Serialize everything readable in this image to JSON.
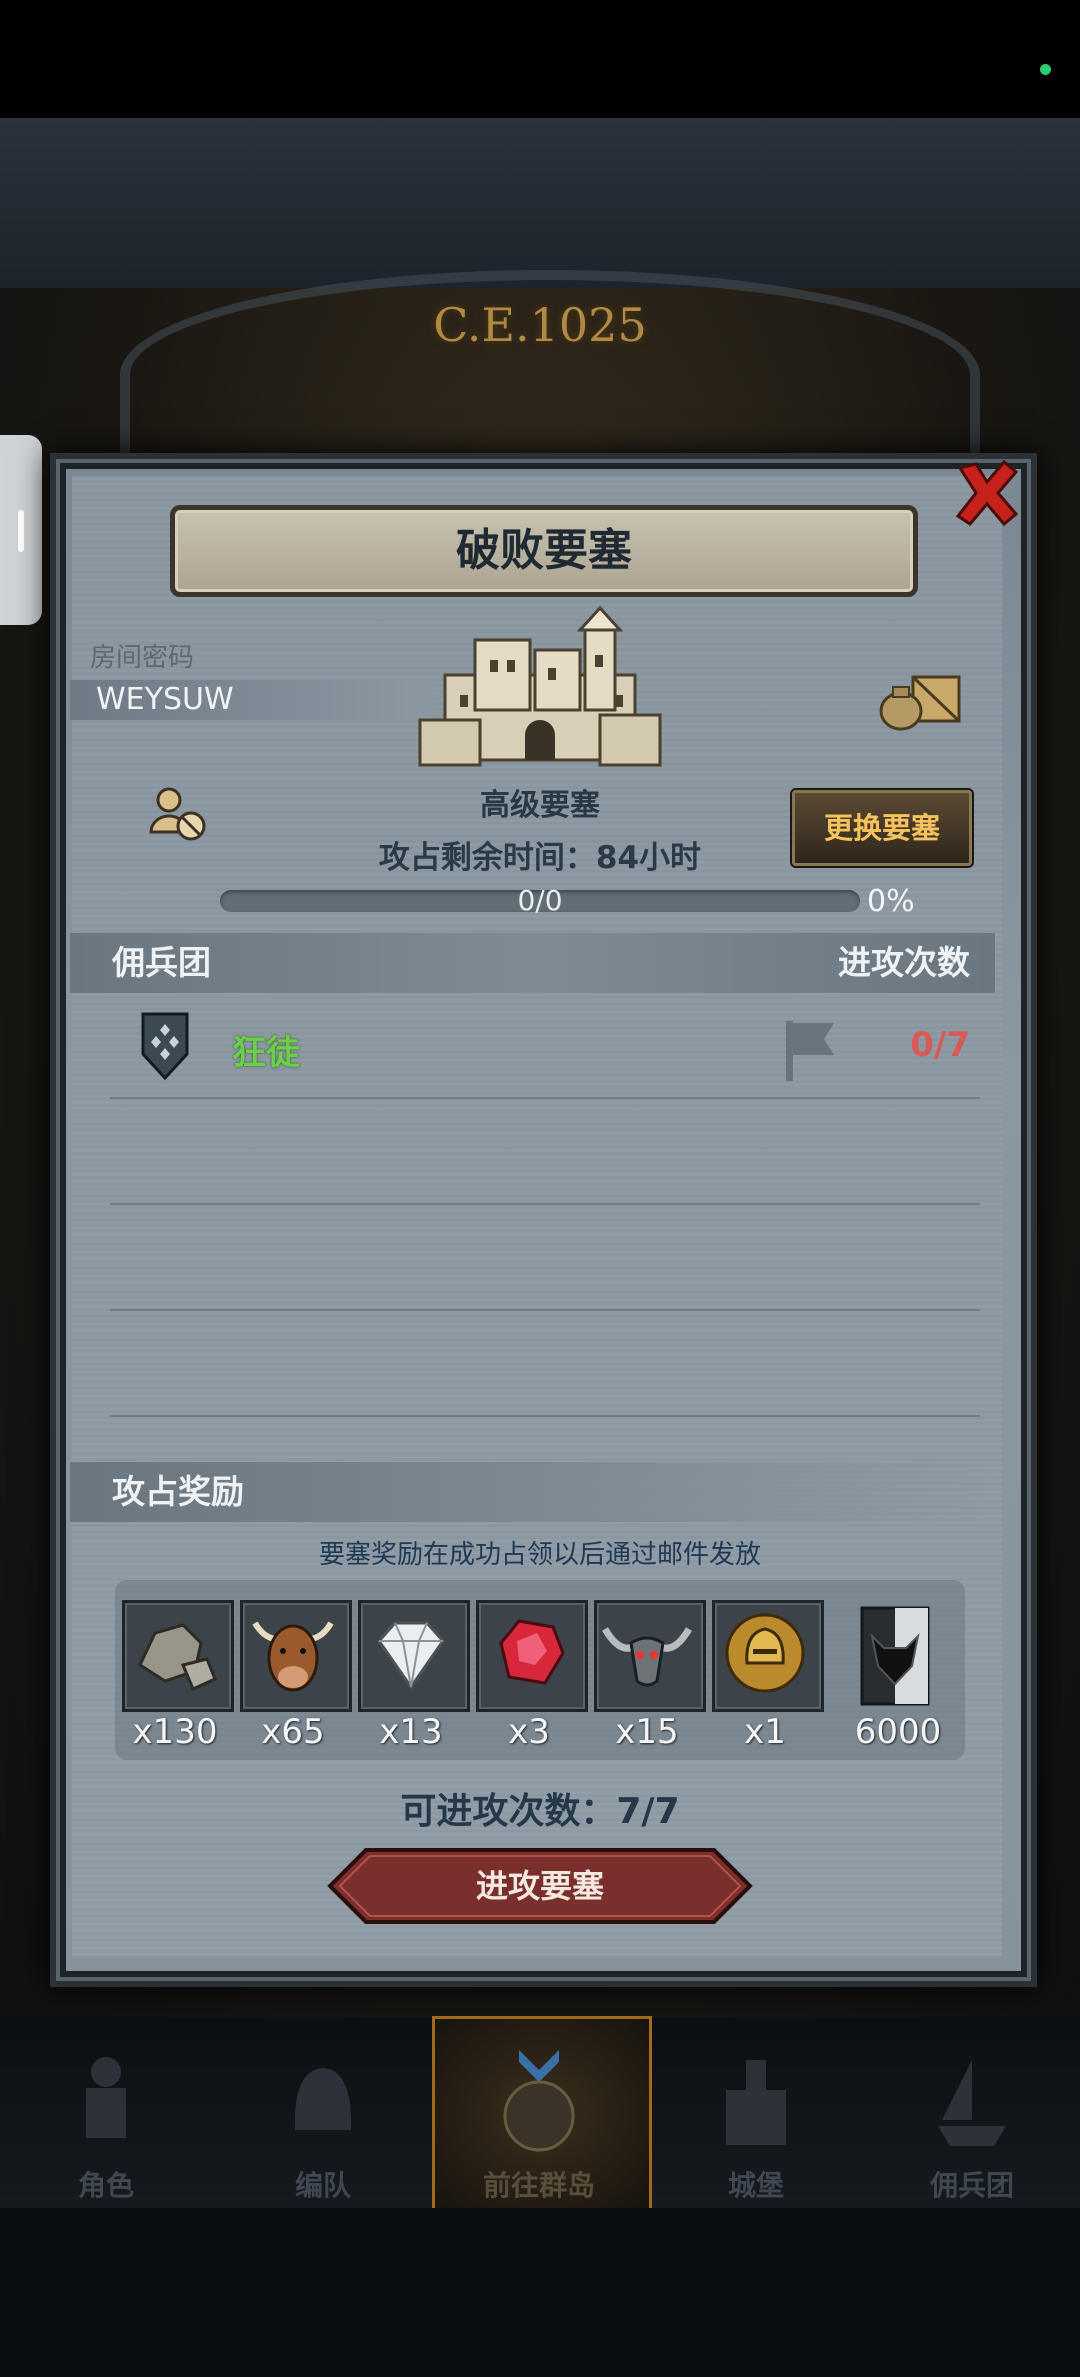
{
  "background": {
    "era": "C.E.1025"
  },
  "dialog": {
    "title": "破败要塞",
    "room_label": "房间密码",
    "room_code": "WEYSUW",
    "fortress_level": "高级要塞",
    "change_button": "更换要塞",
    "remaining_time": "攻占剩余时间：84小时",
    "progress": {
      "text": "0/0",
      "percent_label": "0%",
      "value": 0
    },
    "mercenary_header": "佣兵团",
    "attack_count_header": "进攻次数",
    "guilds": [
      {
        "name": "狂徒",
        "attacks": "0/7"
      }
    ],
    "reward_header": "攻占奖励",
    "reward_note": "要塞奖励在成功占领以后通过邮件发放",
    "rewards": [
      {
        "icon": "stone-icon",
        "qty": "x130"
      },
      {
        "icon": "ox-head-icon",
        "qty": "x65"
      },
      {
        "icon": "diamond-icon",
        "qty": "x13"
      },
      {
        "icon": "ruby-icon",
        "qty": "x3"
      },
      {
        "icon": "horned-skull-icon",
        "qty": "x15"
      },
      {
        "icon": "gold-helmet-icon",
        "qty": "x1"
      },
      {
        "icon": "merit-badge-icon",
        "qty": "6000"
      }
    ],
    "attacks_left": "可进攻次数：7/7",
    "attack_button": "进攻要塞"
  },
  "nav": [
    {
      "label": "角色",
      "icon": "knight-icon"
    },
    {
      "label": "编队",
      "icon": "helmet-icon"
    },
    {
      "label": "前往群岛",
      "icon": "globe-icon"
    },
    {
      "label": "城堡",
      "icon": "castle-icon"
    },
    {
      "label": "佣兵团",
      "icon": "ship-icon"
    }
  ],
  "colors": {
    "guild_name": "#6ad04a",
    "attack_count": "#d95a55",
    "change_button_text": "#f6c35c",
    "attack_button": "#7a2f2c"
  }
}
